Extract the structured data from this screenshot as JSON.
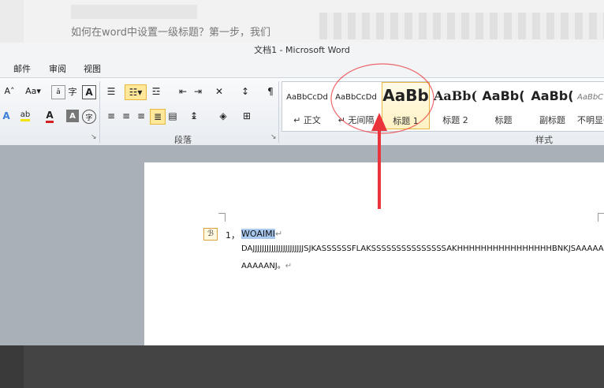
{
  "background": {
    "caption_text": "如何在word中设置一级标题？第一步，我们"
  },
  "window": {
    "title": "文档1 - Microsoft Word"
  },
  "tabs": [
    {
      "label": "邮件"
    },
    {
      "label": "审阅"
    },
    {
      "label": "视图"
    }
  ],
  "ribbon": {
    "font_group": {
      "font_size_grow": "A˄",
      "change_case": "Aa▾"
    },
    "paragraph_group": {
      "label": "段落"
    },
    "styles_group": {
      "label": "样式",
      "items": [
        {
          "preview": "AaBbCcDd",
          "label": "↵ 正文"
        },
        {
          "preview": "AaBbCcDd",
          "label": "↵ 无间隔"
        },
        {
          "preview": "AaBb",
          "label": "标题 1"
        },
        {
          "preview": "AaBb(",
          "label": "标题 2"
        },
        {
          "preview": "AaBb(",
          "label": "标题"
        },
        {
          "preview": "AaBb(",
          "label": "副标题"
        },
        {
          "preview": "AaBbC",
          "label": "不明显强"
        }
      ]
    }
  },
  "document": {
    "list_number": "1，",
    "line1_selected": "WOAIMI",
    "line2": "DAJJJJJJJJJJJJJJJJJJJJJJSJKASSSSSSFLAKSSSSSSSSSSSSSSSAKHHHHHHHHHHHHHHHHBNKJSAAAAA",
    "line3": "AAAAANJ。",
    "para_mark": "↵"
  },
  "colors": {
    "selection": "#a9c9f0",
    "annotation": "#e8343a",
    "selected_style_border": "#e7b63f"
  }
}
